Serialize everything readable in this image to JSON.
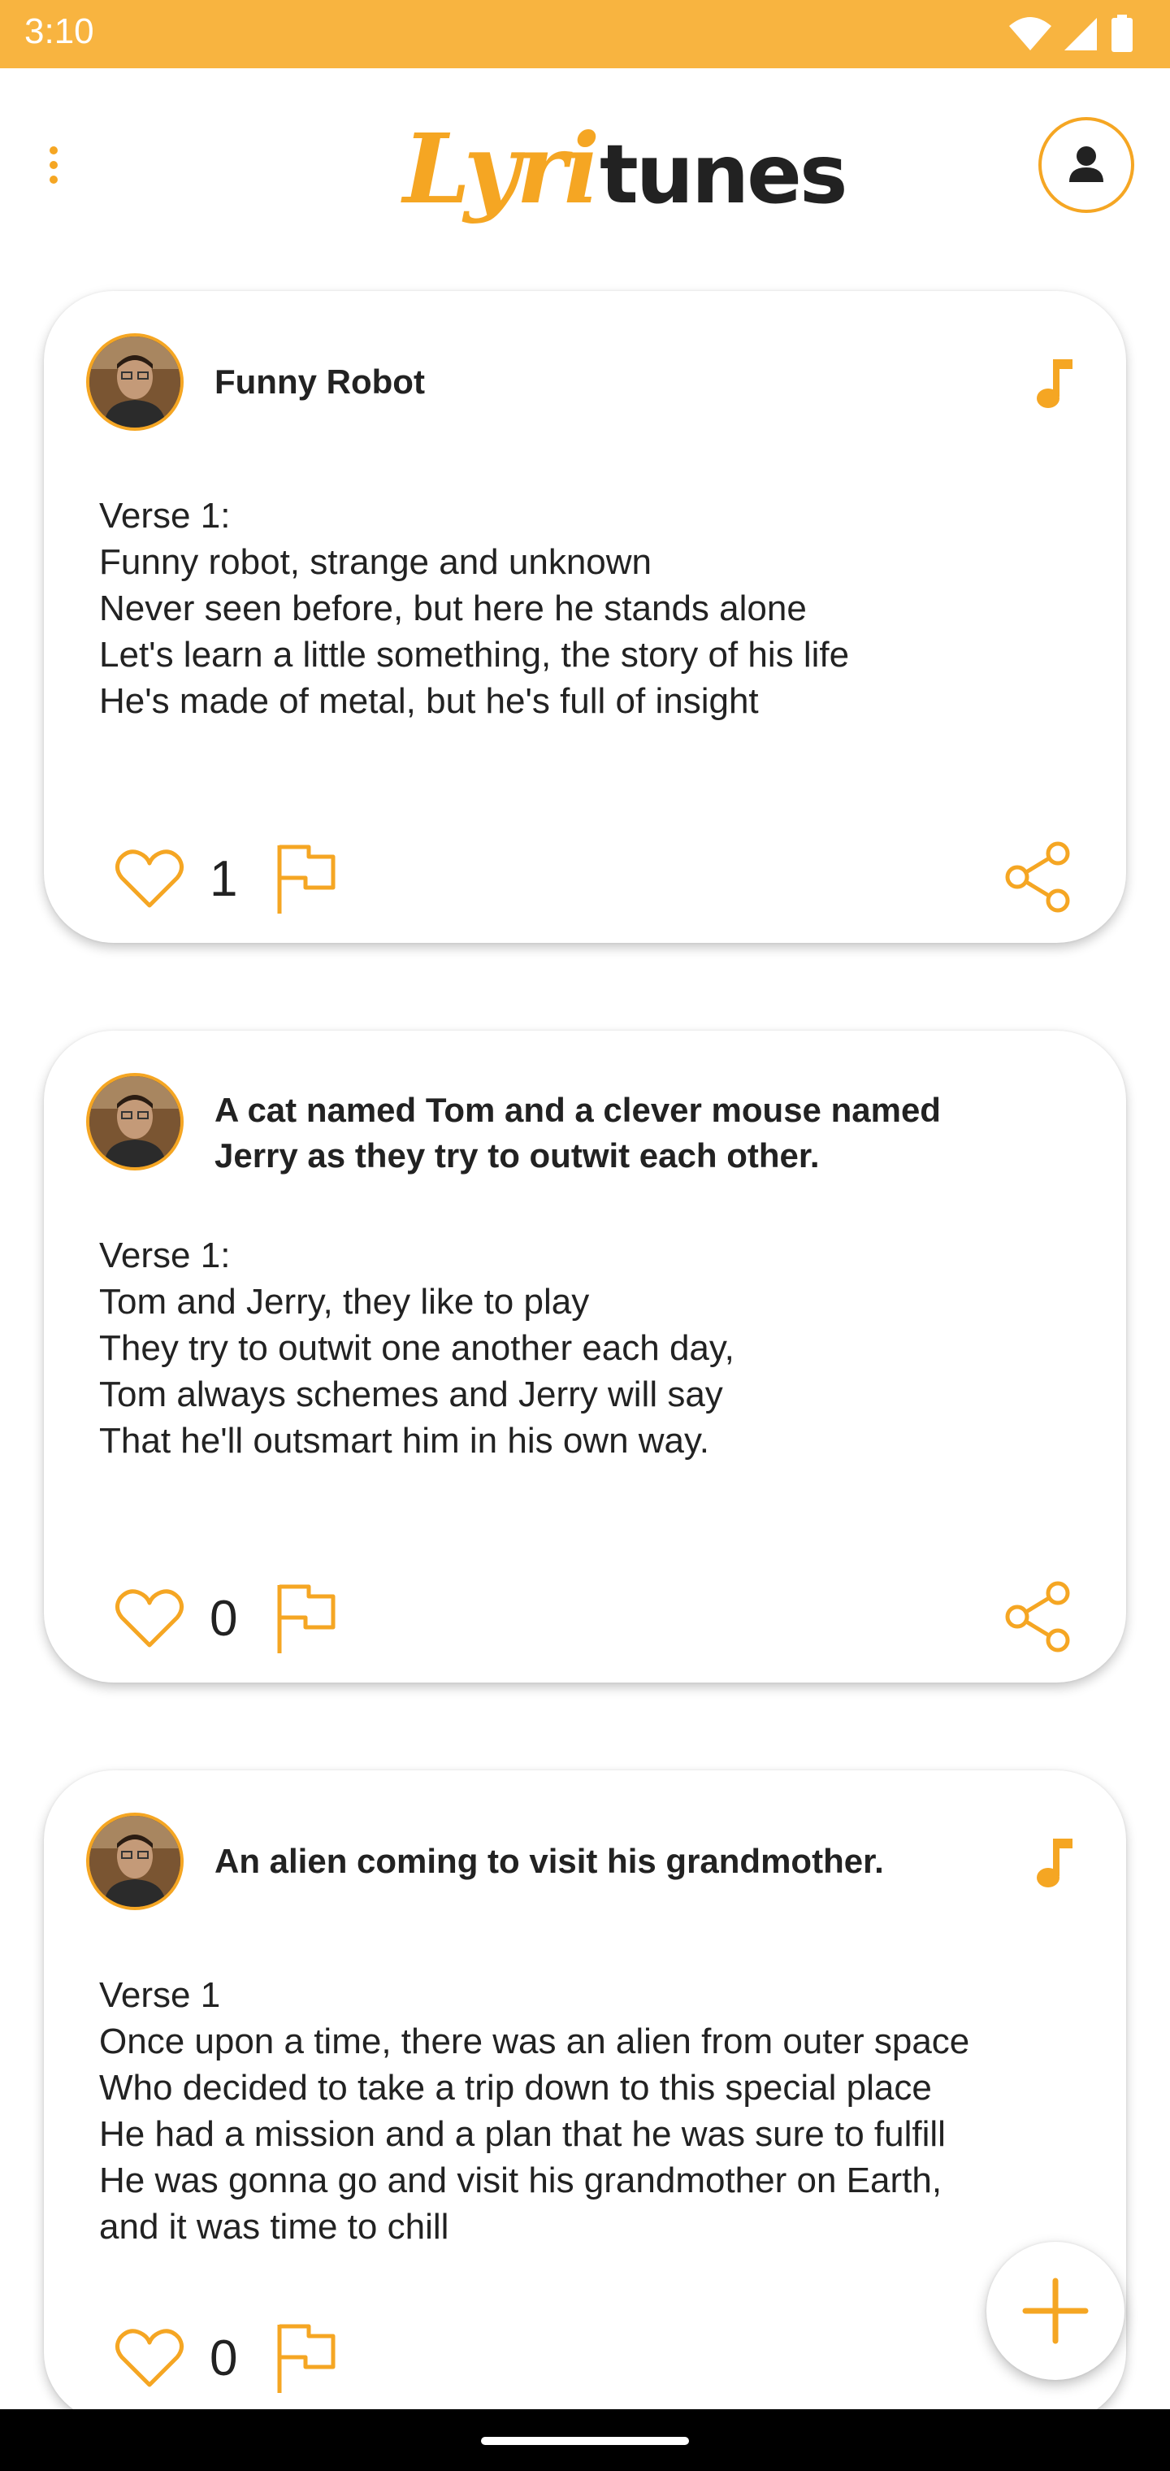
{
  "status_bar": {
    "time": "3:10",
    "icons": [
      "wifi-icon",
      "signal-icon",
      "battery-icon"
    ]
  },
  "app_bar": {
    "logo_part1": "Lyri",
    "logo_part2": "tunes",
    "menu_icon": "more-vert-icon",
    "profile_icon": "user-icon"
  },
  "colors": {
    "accent": "#F5A623",
    "status_bar": "#F8B440",
    "text": "#222222"
  },
  "posts": [
    {
      "title": "Funny Robot",
      "lyrics": "Verse 1:\nFunny robot, strange and unknown\nNever seen before, but here he stands alone\nLet's learn a little something, the story of his life\nHe's made of metal, but he's full of insight",
      "likes": "1",
      "has_music_icon": true
    },
    {
      "title": "A cat named Tom and a clever mouse named Jerry as they try to outwit each other.",
      "lyrics": "Verse 1:\nTom and Jerry, they like to play\nThey try to outwit one another each day,\nTom always schemes and Jerry will say\nThat he'll outsmart him in his own way.",
      "likes": "0",
      "has_music_icon": false
    },
    {
      "title": "An alien coming to visit his grandmother.",
      "lyrics": "Verse 1\nOnce upon a time, there was an alien from outer space\nWho decided to take a trip down to this special place\nHe had a mission and a plan that he was sure to fulfill\nHe was gonna go and visit his grandmother on Earth,\nand it was time to chill",
      "likes": "0",
      "has_music_icon": true
    }
  ],
  "fab": {
    "icon": "plus-icon"
  }
}
